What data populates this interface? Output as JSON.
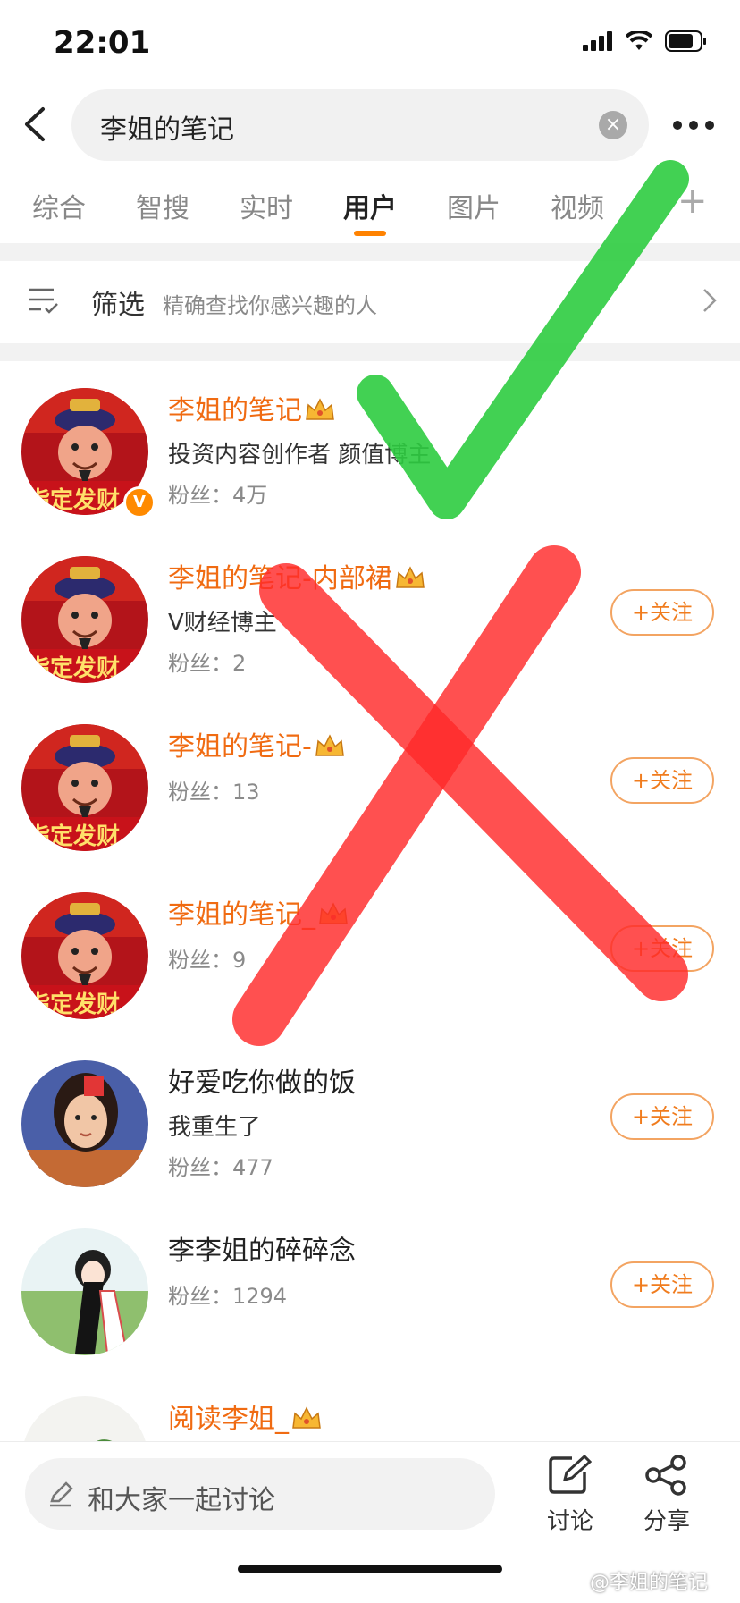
{
  "status_bar": {
    "time": "22:01"
  },
  "search": {
    "query": "李姐的笔记",
    "clear_symbol": "×"
  },
  "tabs": [
    {
      "label": "综合"
    },
    {
      "label": "智搜"
    },
    {
      "label": "实时"
    },
    {
      "label": "用户",
      "active": true
    },
    {
      "label": "图片"
    },
    {
      "label": "视频"
    }
  ],
  "tab_add_symbol": "+",
  "filter": {
    "label": "筛选",
    "desc": "精确查找你感兴趣的人"
  },
  "users": [
    {
      "name": "李姐的笔记",
      "desc": "投资内容创作者 颜值博主",
      "fans": "粉丝：4万",
      "verified_badge": "V",
      "name_color": "#f06b12",
      "crown": true
    },
    {
      "name": "李姐的笔记-内部裙",
      "desc": "V财经博主",
      "fans": "粉丝：2",
      "follow": "+关注",
      "name_color": "#f06b12",
      "crown": true
    },
    {
      "name": "李姐的笔记-",
      "fans": "粉丝：13",
      "follow": "+关注",
      "name_color": "#f06b12",
      "crown": true
    },
    {
      "name": "李姐的笔记_",
      "fans": "粉丝：9",
      "follow": "+关注",
      "name_color": "#f06b12",
      "crown": true
    },
    {
      "name": "好爱吃你做的饭",
      "desc": "我重生了",
      "fans": "粉丝：477",
      "follow": "+关注",
      "name_color": "#222222"
    },
    {
      "name": "李李姐的碎碎念",
      "fans": "粉丝：1294",
      "follow": "+关注",
      "name_color": "#222222"
    },
    {
      "name": "阅读李姐_",
      "name_color": "#f06b12",
      "crown": true
    }
  ],
  "bottom": {
    "comment_placeholder": "和大家一起讨论",
    "discuss_label": "讨论",
    "share_label": "分享"
  },
  "watermark": "@李姐的笔记",
  "colors": {
    "accent": "#ff8200",
    "follow_border": "#f3a462",
    "check_mark": "#2ecc40",
    "cross_mark": "#ff2a2a"
  },
  "icons": [
    "back-arrow-icon",
    "clear-icon",
    "more-dots-icon",
    "filter-list-icon",
    "chevron-right-icon",
    "crown-icon",
    "edit-icon",
    "share-icon",
    "pen-icon"
  ]
}
